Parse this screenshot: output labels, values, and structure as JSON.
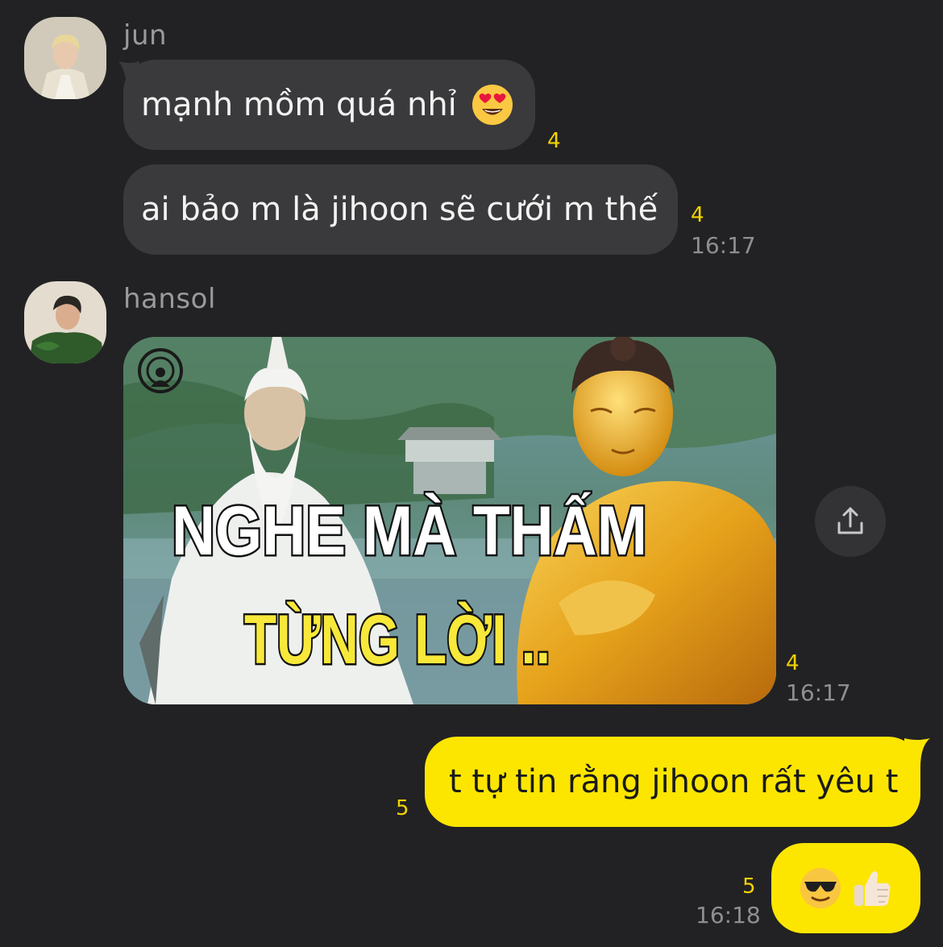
{
  "messages": [
    {
      "sender": "jun",
      "text": "mạnh mồm quá nhỉ",
      "emoji": "heart-eyes-emoji",
      "unread": "4"
    },
    {
      "sender": "jun",
      "text": "ai bảo m là jihoon sẽ cưới m thế",
      "unread": "4",
      "time": "16:17"
    },
    {
      "sender": "hansol",
      "image": {
        "line1": "NGHE MÀ THẤM",
        "line2": "TỪNG LỜI .."
      },
      "unread": "4",
      "time": "16:17"
    },
    {
      "sender": "me",
      "text": "t tự tin rằng jihoon rất yêu t",
      "unread": "5"
    },
    {
      "sender": "me",
      "emoji": [
        "sunglasses-emoji",
        "thumbs-up-emoji"
      ],
      "unread": "5",
      "time": "16:18"
    }
  ],
  "senders": {
    "jun": "jun",
    "hansol": "hansol"
  },
  "colors": {
    "background": "#222224",
    "incoming_bubble": "#3a3a3c",
    "outgoing_bubble": "#fce600",
    "unread_count": "#f2d300"
  }
}
